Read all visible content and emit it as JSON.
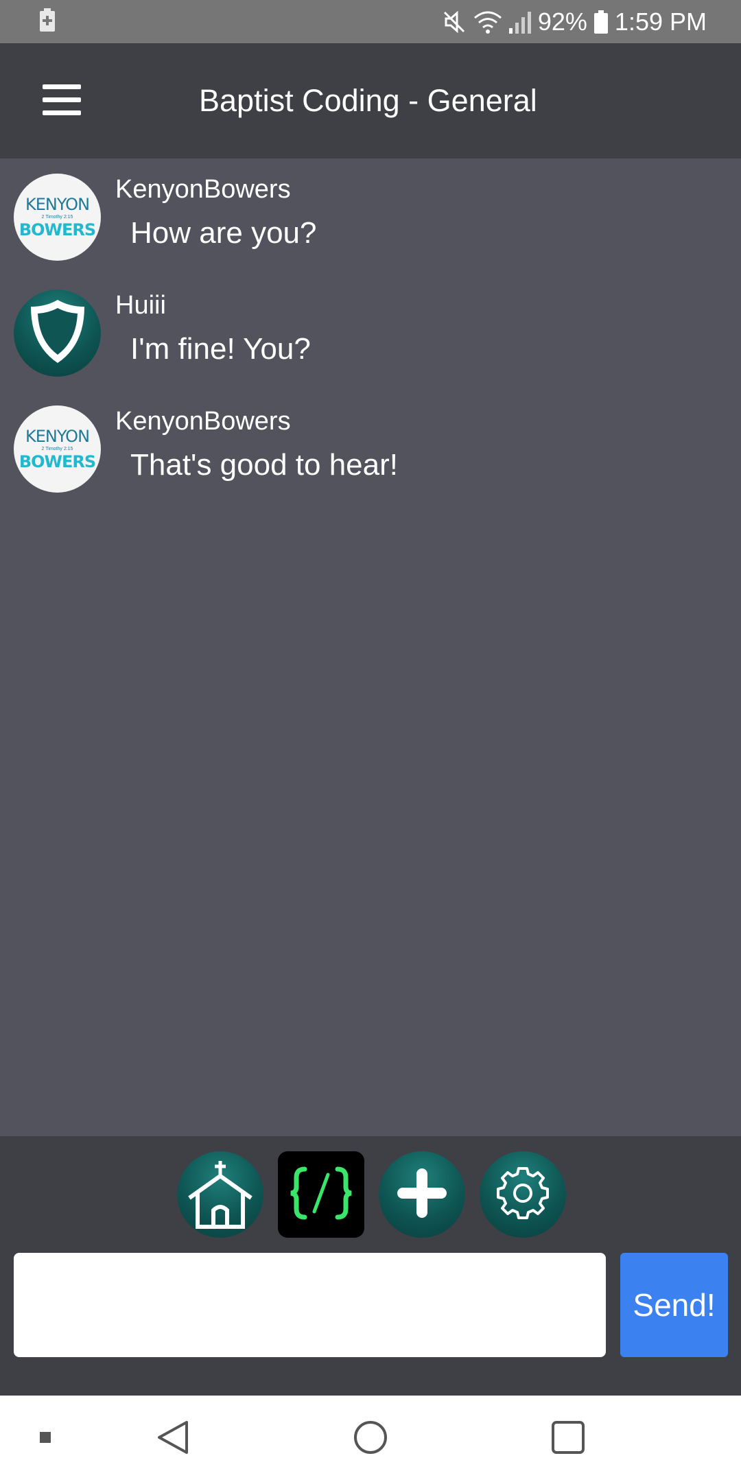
{
  "status_bar": {
    "battery_percent": "92%",
    "time": "1:59 PM",
    "icons": [
      "battery-saver-icon",
      "mute-icon",
      "wifi-icon",
      "signal-icon",
      "battery-icon"
    ]
  },
  "app_bar": {
    "title": "Baptist Coding - General",
    "menu_icon": "hamburger-menu-icon"
  },
  "messages": [
    {
      "user": "KenyonBowers",
      "text": "How are you?",
      "avatar": "kenyon-bowers-logo"
    },
    {
      "user": "Huiii",
      "text": "I'm fine! You?",
      "avatar": "shield-icon"
    },
    {
      "user": "KenyonBowers",
      "text": "That's good to hear!",
      "avatar": "kenyon-bowers-logo"
    }
  ],
  "avatar_logo": {
    "line1": "KENYON",
    "line2": "2 Timothy 2:15",
    "line3": "BOWERS"
  },
  "nav_icons": [
    "church-home-icon",
    "code-icon",
    "plus-icon",
    "gear-icon"
  ],
  "composer": {
    "input_value": "",
    "input_placeholder": "",
    "send_label": "Send!"
  },
  "colors": {
    "status_bar": "#767676",
    "app_bar": "#3f4046",
    "chat_background": "#52535c",
    "teal_button": "#0e5553",
    "send_button": "#3b82f0",
    "code_green": "#39e66a"
  }
}
